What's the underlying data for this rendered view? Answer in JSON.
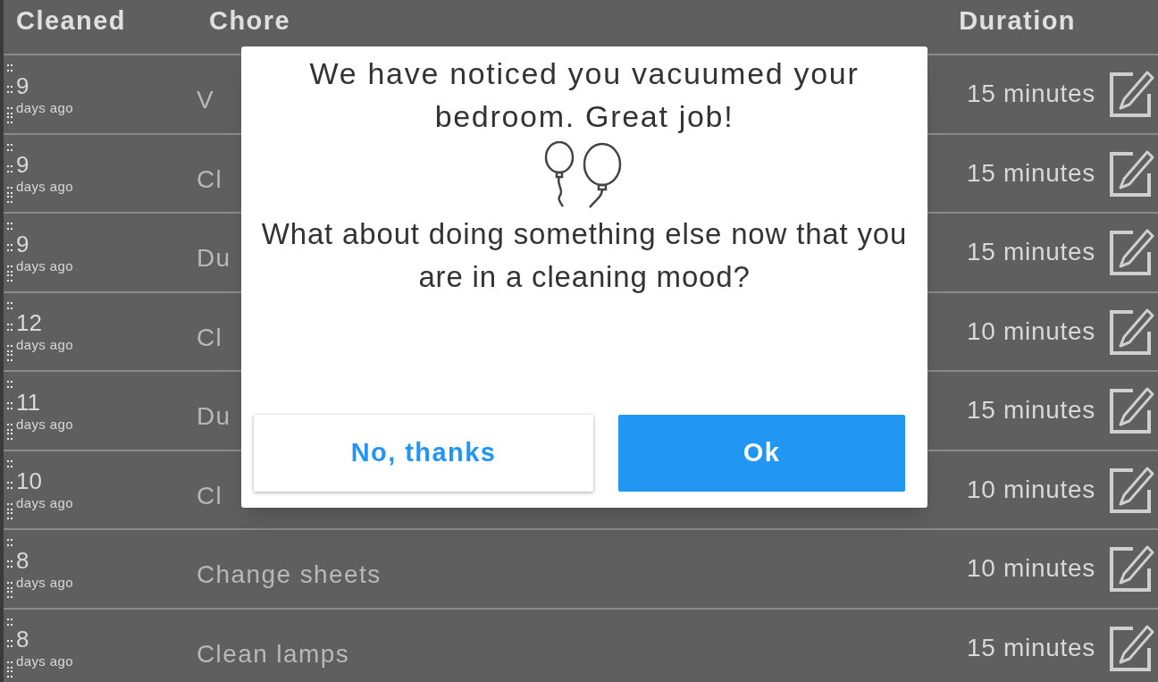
{
  "table": {
    "columns": [
      "Cleaned",
      "Chore",
      "Duration"
    ],
    "rows": [
      {
        "number": "9",
        "unit": "days ago",
        "chore": "V",
        "duration": "15 minutes"
      },
      {
        "number": "9",
        "unit": "days ago",
        "chore": "Cl",
        "duration": "15 minutes"
      },
      {
        "number": "9",
        "unit": "days ago",
        "chore": "Du",
        "duration": "15 minutes"
      },
      {
        "number": "12",
        "unit": "days ago",
        "chore": "Cl",
        "duration": "10 minutes"
      },
      {
        "number": "11",
        "unit": "days ago",
        "chore": "Du",
        "duration": "15 minutes"
      },
      {
        "number": "10",
        "unit": "days ago",
        "chore": "Cl",
        "duration": "10 minutes"
      },
      {
        "number": "8",
        "unit": "days ago",
        "chore": "Change sheets",
        "duration": "10 minutes"
      },
      {
        "number": "8",
        "unit": "days ago",
        "chore": "Clean lamps",
        "duration": "15 minutes"
      }
    ]
  },
  "dialog": {
    "message": "We have noticed you vacuumed your bedroom. Great job!",
    "question": "What about doing something else now that you are in a cleaning mood?",
    "buttons": [
      {
        "label": "No, thanks",
        "kind": "secondary"
      },
      {
        "label": "Ok",
        "kind": "primary"
      }
    ]
  }
}
